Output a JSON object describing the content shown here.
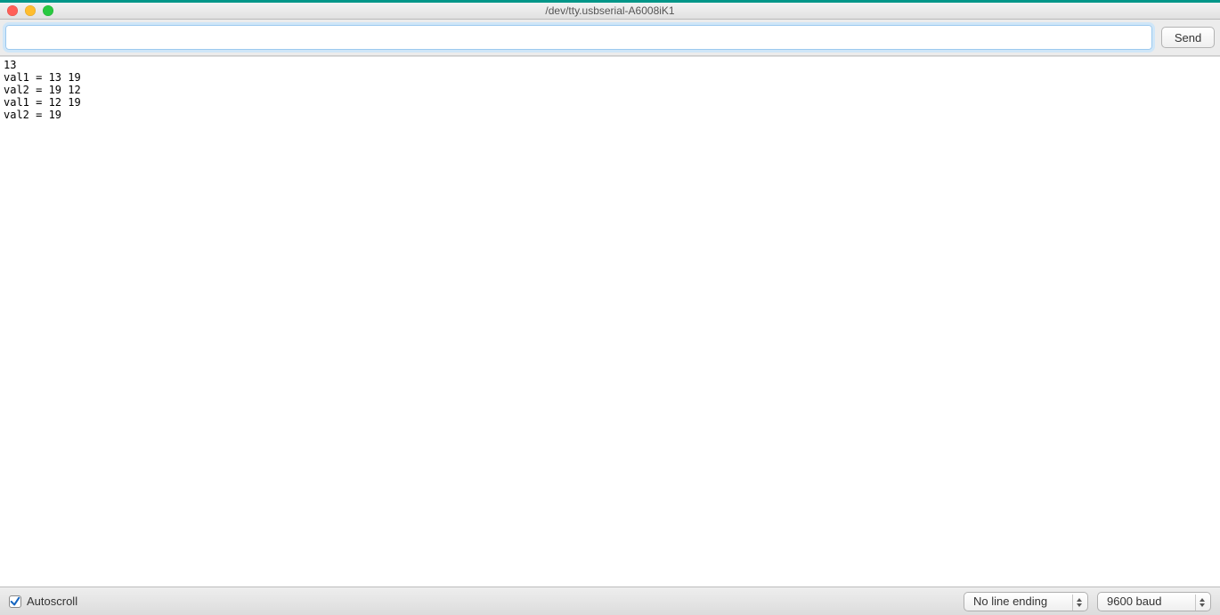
{
  "window": {
    "title": "/dev/tty.usbserial-A6008iK1"
  },
  "input": {
    "value": "",
    "send_label": "Send"
  },
  "output": {
    "text": "13\nval1 = 13 19\nval2 = 19 12\nval1 = 12 19\nval2 = 19"
  },
  "bottom": {
    "autoscroll_label": "Autoscroll",
    "autoscroll_checked": true,
    "line_ending": {
      "selected": "No line ending"
    },
    "baud": {
      "selected": "9600 baud"
    }
  }
}
